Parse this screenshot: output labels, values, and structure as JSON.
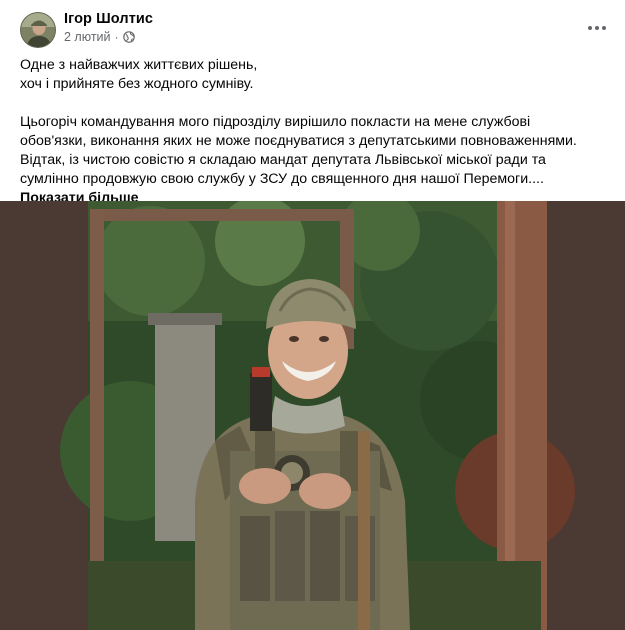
{
  "post": {
    "author": "Ігор Шолтис",
    "timestamp": "2 лютий",
    "separator": "·",
    "privacy_icon": "globe-icon",
    "more_icon": "more-options-icon",
    "text_lines": [
      "Одне з найважчих життєвих рішень,",
      "хоч і прийняте без жодного сумніву.",
      "",
      "Цьогоріч командування мого підрозділу вирішило покласти на мене службові",
      "обов'язки, виконання яких не може поєднуватися з депутатськими повноваженнями.",
      "Відтак, із чистою совістю я складаю мандат депутата Львівської міської ради та",
      "сумлінно продовжую свою службу у ЗСУ до священного дня нашої Перемоги...."
    ],
    "see_more": "Показати більше"
  },
  "colors": {
    "text_primary": "#050505",
    "text_secondary": "#65676b",
    "photo_frame": "#4a3a33"
  }
}
